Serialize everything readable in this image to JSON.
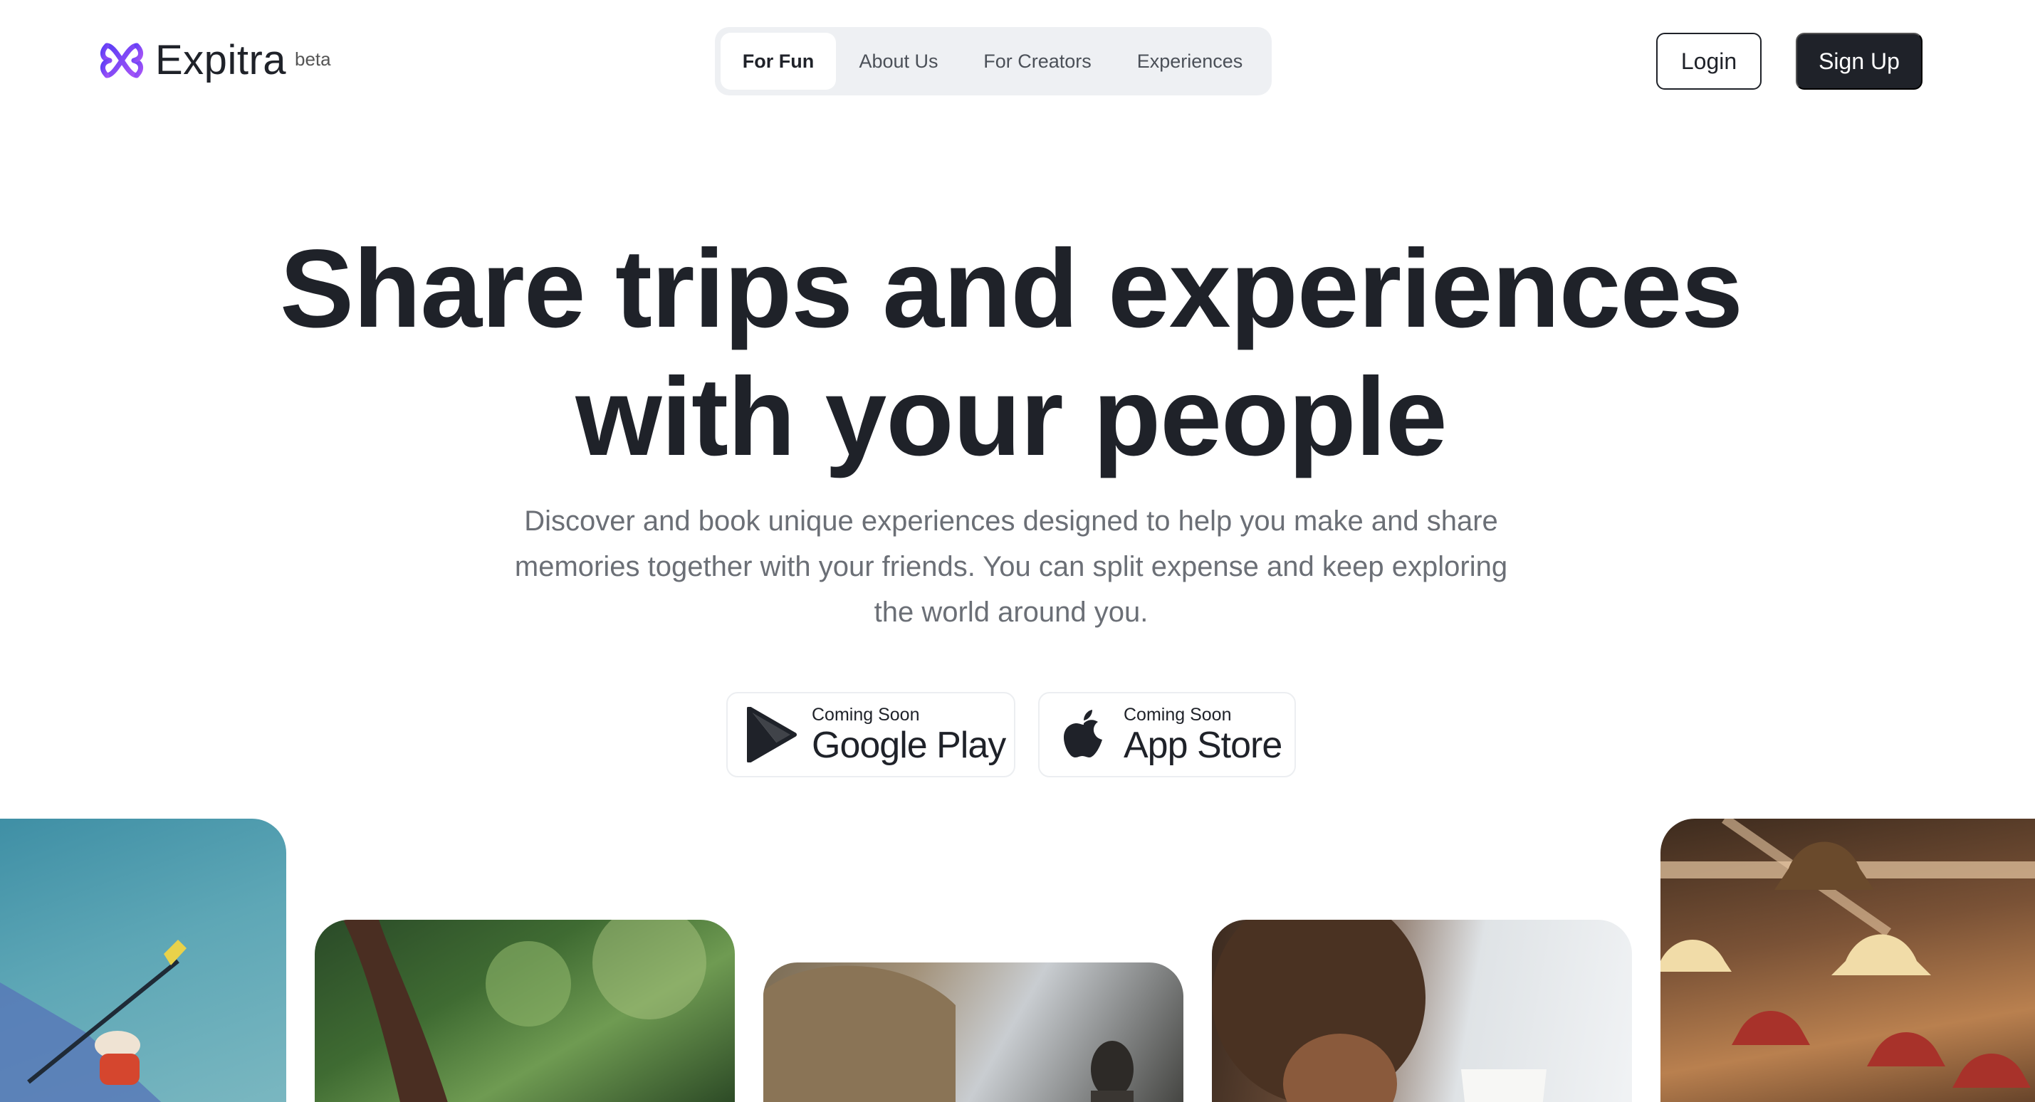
{
  "brand": {
    "name": "Expitra",
    "tag": "beta",
    "accent": "#7c3aed"
  },
  "nav": {
    "items": [
      {
        "label": "For Fun",
        "active": true
      },
      {
        "label": "About Us",
        "active": false
      },
      {
        "label": "For Creators",
        "active": false
      },
      {
        "label": "Experiences",
        "active": false
      }
    ]
  },
  "auth": {
    "login_label": "Login",
    "signup_label": "Sign Up"
  },
  "hero": {
    "title_line1": "Share trips and experiences",
    "title_line2": "with your people",
    "subtitle": "Discover and book unique experiences designed to help you make and share memories together with your friends. You can split expense and keep exploring the world around you."
  },
  "stores": {
    "google": {
      "small": "Coming Soon",
      "big": "Google Play",
      "icon": "google-play-icon"
    },
    "apple": {
      "small": "Coming Soon",
      "big": "App Store",
      "icon": "apple-icon"
    }
  },
  "photos": [
    {
      "subject": "kayaker on water"
    },
    {
      "subject": "person raising arm under trees"
    },
    {
      "subject": "thatched hut with people"
    },
    {
      "subject": "child with curly hair and cup"
    },
    {
      "subject": "hanging pendant lamps in restaurant"
    }
  ]
}
